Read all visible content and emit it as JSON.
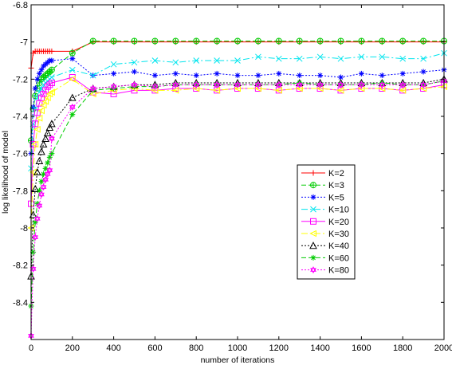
{
  "chart_data": {
    "type": "line",
    "title": "",
    "xlabel": "number of iterations",
    "ylabel": "log likelihood of model",
    "xlim": [
      0,
      2000
    ],
    "ylim": [
      -8.6,
      -6.8
    ],
    "xticks": [
      0,
      200,
      400,
      600,
      800,
      1000,
      1200,
      1400,
      1600,
      1800,
      2000
    ],
    "xtick_labels": [
      "0",
      "200",
      "400",
      "600",
      "800",
      "1000",
      "1200",
      "1400",
      "1600",
      "1800",
      "2000"
    ],
    "yticks": [
      -6.8,
      -7.0,
      -7.2,
      -7.4,
      -7.6,
      -7.8,
      -8.0,
      -8.2,
      -8.4
    ],
    "ytick_labels": [
      "-6.8",
      "-7",
      "-7.2",
      "-7.4",
      "-7.6",
      "-7.8",
      "-8",
      "-8.2",
      "-8.4"
    ],
    "grid": false,
    "legend_position": "center-right",
    "series": [
      {
        "name": "K=2",
        "color": "#ff0000",
        "dash": "",
        "marker": "plus",
        "x": [
          0,
          10,
          20,
          30,
          40,
          50,
          60,
          70,
          80,
          90,
          100,
          200,
          300,
          400,
          500,
          600,
          700,
          800,
          900,
          1000,
          1100,
          1200,
          1300,
          1400,
          1500,
          1600,
          1700,
          1800,
          1900,
          2000
        ],
        "y": [
          -7.14,
          -7.06,
          -7.05,
          -7.05,
          -7.05,
          -7.05,
          -7.05,
          -7.05,
          -7.05,
          -7.05,
          -7.05,
          -7.05,
          -7.0,
          -7.0,
          -7.0,
          -7.0,
          -7.0,
          -7.0,
          -7.0,
          -7.0,
          -7.0,
          -7.0,
          -7.0,
          -7.0,
          -7.0,
          -7.0,
          -7.0,
          -7.0,
          -7.0,
          -7.0
        ]
      },
      {
        "name": "K=3",
        "color": "#00cc00",
        "dash": "6,3",
        "marker": "circleplus",
        "x": [
          0,
          10,
          20,
          30,
          40,
          50,
          60,
          70,
          80,
          90,
          100,
          200,
          300,
          400,
          500,
          600,
          700,
          800,
          900,
          1000,
          1100,
          1200,
          1300,
          1400,
          1500,
          1600,
          1700,
          1800,
          1900,
          2000
        ],
        "y": [
          -7.53,
          -7.36,
          -7.29,
          -7.25,
          -7.22,
          -7.2,
          -7.19,
          -7.18,
          -7.17,
          -7.16,
          -7.15,
          -7.06,
          -6.995,
          -6.995,
          -6.995,
          -6.995,
          -6.995,
          -6.995,
          -6.995,
          -6.995,
          -6.995,
          -6.995,
          -6.995,
          -6.995,
          -6.995,
          -6.995,
          -6.995,
          -6.995,
          -6.995,
          -6.995
        ]
      },
      {
        "name": "K=5",
        "color": "#0000ff",
        "dash": "2,2",
        "marker": "star",
        "x": [
          0,
          10,
          20,
          30,
          40,
          50,
          60,
          70,
          80,
          90,
          100,
          200,
          300,
          400,
          500,
          600,
          700,
          800,
          900,
          1000,
          1100,
          1200,
          1300,
          1400,
          1500,
          1600,
          1700,
          1800,
          1900,
          2000
        ],
        "y": [
          -7.6,
          -7.35,
          -7.25,
          -7.2,
          -7.17,
          -7.15,
          -7.13,
          -7.12,
          -7.11,
          -7.1,
          -7.1,
          -7.09,
          -7.18,
          -7.17,
          -7.16,
          -7.18,
          -7.17,
          -7.18,
          -7.17,
          -7.18,
          -7.18,
          -7.17,
          -7.18,
          -7.18,
          -7.19,
          -7.17,
          -7.18,
          -7.17,
          -7.16,
          -7.15
        ]
      },
      {
        "name": "K=10",
        "color": "#00e5ee",
        "dash": "8,3,2,3",
        "marker": "x",
        "x": [
          0,
          10,
          20,
          30,
          40,
          50,
          60,
          70,
          80,
          90,
          100,
          200,
          300,
          400,
          500,
          600,
          700,
          800,
          900,
          1000,
          1100,
          1200,
          1300,
          1400,
          1500,
          1600,
          1700,
          1800,
          1900,
          2000
        ],
        "y": [
          -7.68,
          -7.44,
          -7.36,
          -7.3,
          -7.27,
          -7.25,
          -7.23,
          -7.22,
          -7.21,
          -7.2,
          -7.19,
          -7.15,
          -7.18,
          -7.12,
          -7.11,
          -7.1,
          -7.11,
          -7.1,
          -7.1,
          -7.1,
          -7.08,
          -7.09,
          -7.09,
          -7.08,
          -7.09,
          -7.08,
          -7.08,
          -7.09,
          -7.09,
          -7.06
        ]
      },
      {
        "name": "K=20",
        "color": "#ff00ff",
        "dash": "",
        "marker": "square",
        "x": [
          0,
          10,
          20,
          30,
          40,
          50,
          60,
          70,
          80,
          90,
          100,
          200,
          300,
          400,
          500,
          600,
          700,
          800,
          900,
          1000,
          1100,
          1200,
          1300,
          1400,
          1500,
          1600,
          1700,
          1800,
          1900,
          2000
        ],
        "y": [
          -7.87,
          -7.55,
          -7.44,
          -7.38,
          -7.33,
          -7.3,
          -7.28,
          -7.26,
          -7.24,
          -7.23,
          -7.22,
          -7.19,
          -7.27,
          -7.28,
          -7.26,
          -7.26,
          -7.25,
          -7.25,
          -7.26,
          -7.25,
          -7.25,
          -7.26,
          -7.25,
          -7.25,
          -7.26,
          -7.25,
          -7.25,
          -7.26,
          -7.25,
          -7.23
        ]
      },
      {
        "name": "K=30",
        "color": "#ffff00",
        "dash": "8,3,2,3",
        "marker": "triangle-left",
        "x": [
          0,
          10,
          20,
          30,
          40,
          50,
          60,
          70,
          80,
          90,
          100,
          200,
          300,
          400,
          500,
          600,
          700,
          800,
          900,
          1000,
          1100,
          1200,
          1300,
          1400,
          1500,
          1600,
          1700,
          1800,
          1900,
          2000
        ],
        "y": [
          -8.0,
          -7.7,
          -7.55,
          -7.47,
          -7.41,
          -7.37,
          -7.34,
          -7.32,
          -7.3,
          -7.28,
          -7.27,
          -7.2,
          -7.28,
          -7.26,
          -7.25,
          -7.26,
          -7.26,
          -7.25,
          -7.26,
          -7.25,
          -7.25,
          -7.26,
          -7.25,
          -7.25,
          -7.26,
          -7.25,
          -7.25,
          -7.26,
          -7.25,
          -7.24
        ]
      },
      {
        "name": "K=40",
        "color": "#000000",
        "dash": "2,2",
        "marker": "triangle-up",
        "x": [
          0,
          10,
          20,
          30,
          40,
          50,
          60,
          70,
          80,
          90,
          100,
          200,
          300,
          400,
          500,
          600,
          700,
          800,
          900,
          1000,
          1100,
          1200,
          1300,
          1400,
          1500,
          1600,
          1700,
          1800,
          1900,
          2000
        ],
        "y": [
          -8.26,
          -7.93,
          -7.79,
          -7.7,
          -7.64,
          -7.59,
          -7.55,
          -7.52,
          -7.49,
          -7.46,
          -7.44,
          -7.3,
          -7.25,
          -7.24,
          -7.23,
          -7.23,
          -7.22,
          -7.22,
          -7.22,
          -7.22,
          -7.22,
          -7.22,
          -7.22,
          -7.22,
          -7.22,
          -7.22,
          -7.22,
          -7.22,
          -7.22,
          -7.2
        ]
      },
      {
        "name": "K=60",
        "color": "#00cc00",
        "dash": "6,3",
        "marker": "star",
        "x": [
          0,
          10,
          20,
          30,
          40,
          50,
          60,
          70,
          80,
          90,
          100,
          200,
          300,
          400,
          500,
          600,
          700,
          800,
          900,
          1000,
          1100,
          1200,
          1300,
          1400,
          1500,
          1600,
          1700,
          1800,
          1900,
          2000
        ],
        "y": [
          -8.42,
          -8.13,
          -7.97,
          -7.87,
          -7.8,
          -7.75,
          -7.71,
          -7.68,
          -7.65,
          -7.62,
          -7.6,
          -7.39,
          -7.26,
          -7.25,
          -7.24,
          -7.24,
          -7.23,
          -7.23,
          -7.23,
          -7.23,
          -7.23,
          -7.23,
          -7.22,
          -7.23,
          -7.23,
          -7.23,
          -7.22,
          -7.23,
          -7.23,
          -7.21
        ]
      },
      {
        "name": "K=80",
        "color": "#ff00ff",
        "dash": "2,2",
        "marker": "hexagram",
        "x": [
          0,
          10,
          20,
          30,
          40,
          50,
          60,
          70,
          80,
          90,
          100,
          200,
          300,
          400,
          500,
          600,
          700,
          800,
          900,
          1000,
          1100,
          1200,
          1300,
          1400,
          1500,
          1600,
          1700,
          1800,
          1900,
          2000
        ],
        "y": [
          -8.58,
          -8.22,
          -8.05,
          -7.95,
          -7.88,
          -7.82,
          -7.78,
          -7.74,
          -7.71,
          -7.69,
          -7.52,
          -7.35,
          -7.25,
          -7.24,
          -7.23,
          -7.24,
          -7.23,
          -7.23,
          -7.23,
          -7.23,
          -7.23,
          -7.23,
          -7.23,
          -7.23,
          -7.23,
          -7.23,
          -7.23,
          -7.23,
          -7.23,
          -7.21
        ]
      }
    ]
  }
}
